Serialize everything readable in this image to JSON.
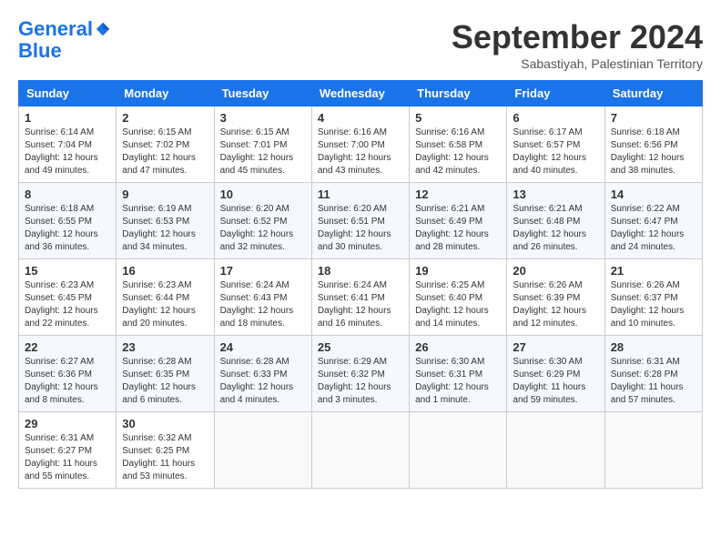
{
  "header": {
    "logo_line1": "General",
    "logo_line2": "Blue",
    "month": "September 2024",
    "location": "Sabastiyah, Palestinian Territory"
  },
  "weekdays": [
    "Sunday",
    "Monday",
    "Tuesday",
    "Wednesday",
    "Thursday",
    "Friday",
    "Saturday"
  ],
  "weeks": [
    [
      {
        "day": "1",
        "sunrise": "6:14 AM",
        "sunset": "7:04 PM",
        "daylight": "12 hours and 49 minutes."
      },
      {
        "day": "2",
        "sunrise": "6:15 AM",
        "sunset": "7:02 PM",
        "daylight": "12 hours and 47 minutes."
      },
      {
        "day": "3",
        "sunrise": "6:15 AM",
        "sunset": "7:01 PM",
        "daylight": "12 hours and 45 minutes."
      },
      {
        "day": "4",
        "sunrise": "6:16 AM",
        "sunset": "7:00 PM",
        "daylight": "12 hours and 43 minutes."
      },
      {
        "day": "5",
        "sunrise": "6:16 AM",
        "sunset": "6:58 PM",
        "daylight": "12 hours and 42 minutes."
      },
      {
        "day": "6",
        "sunrise": "6:17 AM",
        "sunset": "6:57 PM",
        "daylight": "12 hours and 40 minutes."
      },
      {
        "day": "7",
        "sunrise": "6:18 AM",
        "sunset": "6:56 PM",
        "daylight": "12 hours and 38 minutes."
      }
    ],
    [
      {
        "day": "8",
        "sunrise": "6:18 AM",
        "sunset": "6:55 PM",
        "daylight": "12 hours and 36 minutes."
      },
      {
        "day": "9",
        "sunrise": "6:19 AM",
        "sunset": "6:53 PM",
        "daylight": "12 hours and 34 minutes."
      },
      {
        "day": "10",
        "sunrise": "6:20 AM",
        "sunset": "6:52 PM",
        "daylight": "12 hours and 32 minutes."
      },
      {
        "day": "11",
        "sunrise": "6:20 AM",
        "sunset": "6:51 PM",
        "daylight": "12 hours and 30 minutes."
      },
      {
        "day": "12",
        "sunrise": "6:21 AM",
        "sunset": "6:49 PM",
        "daylight": "12 hours and 28 minutes."
      },
      {
        "day": "13",
        "sunrise": "6:21 AM",
        "sunset": "6:48 PM",
        "daylight": "12 hours and 26 minutes."
      },
      {
        "day": "14",
        "sunrise": "6:22 AM",
        "sunset": "6:47 PM",
        "daylight": "12 hours and 24 minutes."
      }
    ],
    [
      {
        "day": "15",
        "sunrise": "6:23 AM",
        "sunset": "6:45 PM",
        "daylight": "12 hours and 22 minutes."
      },
      {
        "day": "16",
        "sunrise": "6:23 AM",
        "sunset": "6:44 PM",
        "daylight": "12 hours and 20 minutes."
      },
      {
        "day": "17",
        "sunrise": "6:24 AM",
        "sunset": "6:43 PM",
        "daylight": "12 hours and 18 minutes."
      },
      {
        "day": "18",
        "sunrise": "6:24 AM",
        "sunset": "6:41 PM",
        "daylight": "12 hours and 16 minutes."
      },
      {
        "day": "19",
        "sunrise": "6:25 AM",
        "sunset": "6:40 PM",
        "daylight": "12 hours and 14 minutes."
      },
      {
        "day": "20",
        "sunrise": "6:26 AM",
        "sunset": "6:39 PM",
        "daylight": "12 hours and 12 minutes."
      },
      {
        "day": "21",
        "sunrise": "6:26 AM",
        "sunset": "6:37 PM",
        "daylight": "12 hours and 10 minutes."
      }
    ],
    [
      {
        "day": "22",
        "sunrise": "6:27 AM",
        "sunset": "6:36 PM",
        "daylight": "12 hours and 8 minutes."
      },
      {
        "day": "23",
        "sunrise": "6:28 AM",
        "sunset": "6:35 PM",
        "daylight": "12 hours and 6 minutes."
      },
      {
        "day": "24",
        "sunrise": "6:28 AM",
        "sunset": "6:33 PM",
        "daylight": "12 hours and 4 minutes."
      },
      {
        "day": "25",
        "sunrise": "6:29 AM",
        "sunset": "6:32 PM",
        "daylight": "12 hours and 3 minutes."
      },
      {
        "day": "26",
        "sunrise": "6:30 AM",
        "sunset": "6:31 PM",
        "daylight": "12 hours and 1 minute."
      },
      {
        "day": "27",
        "sunrise": "6:30 AM",
        "sunset": "6:29 PM",
        "daylight": "11 hours and 59 minutes."
      },
      {
        "day": "28",
        "sunrise": "6:31 AM",
        "sunset": "6:28 PM",
        "daylight": "11 hours and 57 minutes."
      }
    ],
    [
      {
        "day": "29",
        "sunrise": "6:31 AM",
        "sunset": "6:27 PM",
        "daylight": "11 hours and 55 minutes."
      },
      {
        "day": "30",
        "sunrise": "6:32 AM",
        "sunset": "6:25 PM",
        "daylight": "11 hours and 53 minutes."
      },
      null,
      null,
      null,
      null,
      null
    ]
  ],
  "labels": {
    "sunrise": "Sunrise:",
    "sunset": "Sunset:",
    "daylight": "Daylight:"
  }
}
